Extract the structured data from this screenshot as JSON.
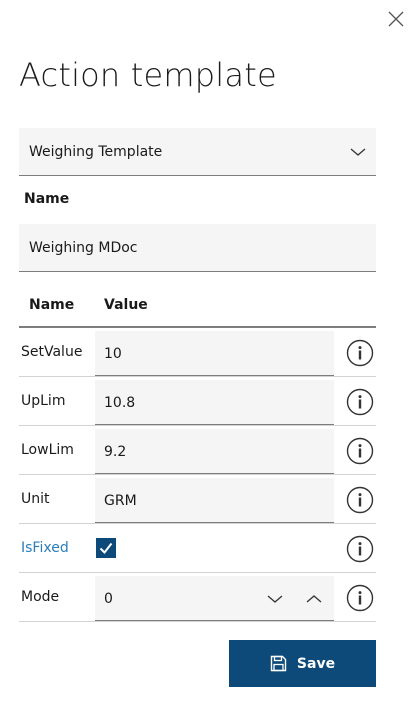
{
  "dialog": {
    "title": "Action template",
    "close_icon": "close-icon"
  },
  "template_select": {
    "selected": "Weighing Template",
    "icon": "chevron-down-icon"
  },
  "name_section": {
    "label": "Name",
    "value": "Weighing MDoc"
  },
  "params_table": {
    "headers": {
      "name": "Name",
      "value": "Value"
    },
    "rows": [
      {
        "name": "SetValue",
        "value": "10"
      },
      {
        "name": "UpLim",
        "value": "10.8"
      },
      {
        "name": "LowLim",
        "value": "9.2"
      },
      {
        "name": "Unit",
        "value": "GRM"
      },
      {
        "name": "IsFixed",
        "checked": true
      },
      {
        "name": "Mode",
        "value": "0"
      }
    ],
    "info_icon": "info-icon"
  },
  "footer": {
    "save_label": "Save",
    "save_icon": "floppy-disk-icon"
  },
  "colors": {
    "primary": "#0d4a79",
    "link": "#2b7eb8",
    "field_bg": "#f5f5f5",
    "underline": "#7d7d7d"
  }
}
